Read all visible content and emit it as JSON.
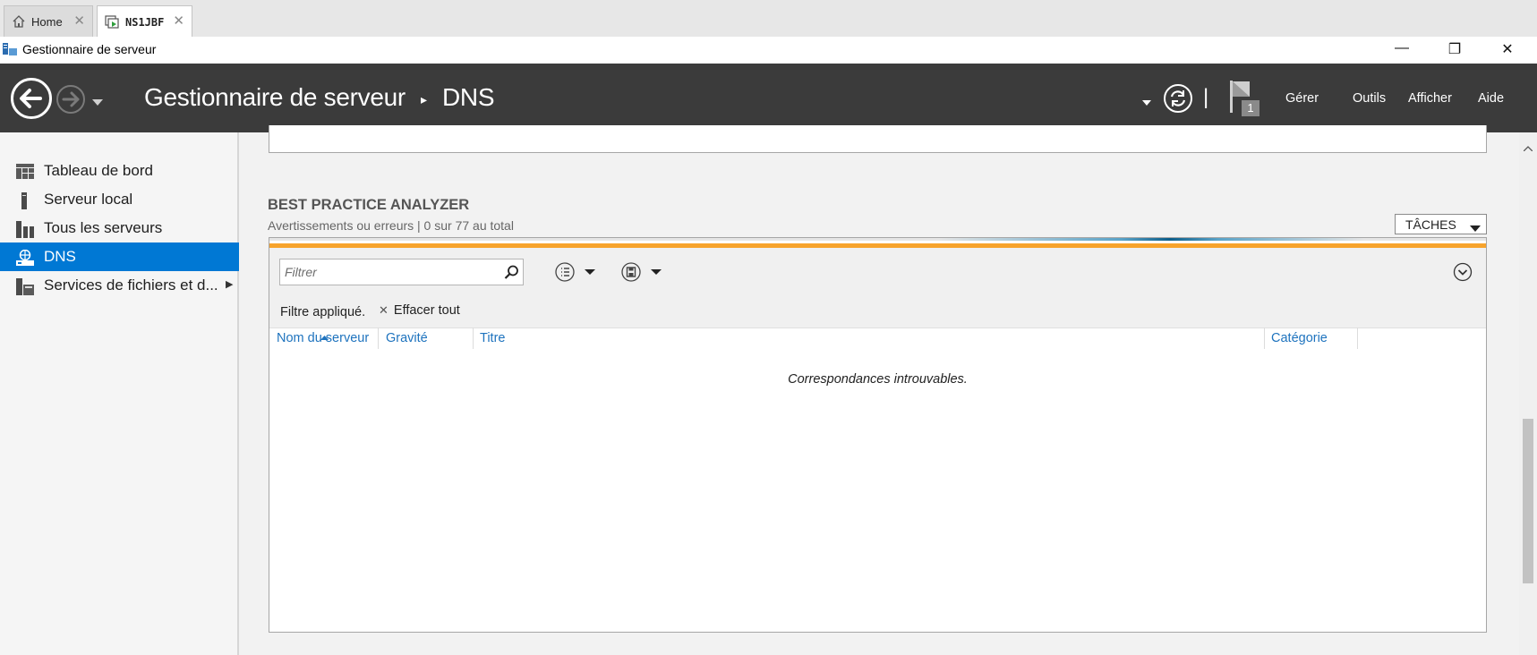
{
  "tabs": [
    {
      "label": "Home",
      "icon": "home-icon",
      "active": false
    },
    {
      "label": "NS1JBF",
      "icon": "vm-console-icon",
      "active": true
    }
  ],
  "window": {
    "title": "Gestionnaire de serveur",
    "icon": "server-manager-icon",
    "controls": {
      "minimize": "—",
      "maximize": "❐",
      "close": "✕"
    }
  },
  "header": {
    "breadcrumb_root": "Gestionnaire de serveur",
    "breadcrumb_sep": "▸",
    "breadcrumb_current": "DNS",
    "notification_count": "1",
    "divider": "|",
    "menu": {
      "manage": "Gérer",
      "tools": "Outils",
      "view": "Afficher",
      "help": "Aide"
    }
  },
  "sidebar": {
    "items": [
      {
        "label": "Tableau de bord",
        "icon": "dashboard-icon",
        "selected": false
      },
      {
        "label": "Serveur local",
        "icon": "local-server-icon",
        "selected": false
      },
      {
        "label": "Tous les serveurs",
        "icon": "all-servers-icon",
        "selected": false
      },
      {
        "label": "DNS",
        "icon": "dns-icon",
        "selected": true
      },
      {
        "label": "Services de fichiers et d...",
        "icon": "file-services-icon",
        "selected": false,
        "expand": "▶"
      }
    ]
  },
  "bpa": {
    "title": "BEST PRACTICE ANALYZER",
    "subtitle": "Avertissements ou erreurs | 0 sur 77 au total",
    "tasks_label": "TÂCHES",
    "filter_placeholder": "Filtrer",
    "filter_applied": "Filtre appliqué.",
    "clear_all": "Effacer tout",
    "columns": [
      "Nom du serveur",
      "Gravité",
      "Titre",
      "Catégorie"
    ],
    "empty_message": "Correspondances introuvables."
  },
  "colors": {
    "header_bg": "#3b3b3b",
    "selected_bg": "#0078d4",
    "accent_orange": "#f7a32c",
    "column_header": "#1e73be"
  }
}
